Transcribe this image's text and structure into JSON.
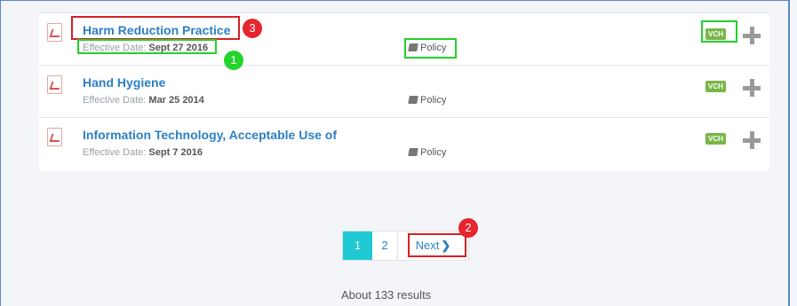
{
  "results": [
    {
      "title": "Harm Reduction Practice",
      "date_label": "Effective Date:",
      "date": "Sept 27 2016",
      "type": "Policy",
      "authority": "VCH",
      "file_icon": "pdf-icon",
      "add_icon": "plus-icon"
    },
    {
      "title": "Hand Hygiene",
      "date_label": "Effective Date:",
      "date": "Mar 25 2014",
      "type": "Policy",
      "authority": "VCH",
      "file_icon": "pdf-icon",
      "add_icon": "plus-icon"
    },
    {
      "title": "Information Technology, Acceptable Use of",
      "date_label": "Effective Date:",
      "date": "Sept 7 2016",
      "type": "Policy",
      "authority": "VCH",
      "file_icon": "pdf-icon",
      "add_icon": "plus-icon"
    }
  ],
  "pagination": {
    "page1": "1",
    "page2": "2",
    "next": "Next",
    "next_icon": "chevron-right-icon",
    "current_page": 1
  },
  "result_count": "About 133 results",
  "annotations": {
    "marker1": "1",
    "marker2": "2",
    "marker3": "3"
  },
  "colors": {
    "accent": "#2c7fc4",
    "active_page": "#1fc9d3",
    "vch_badge": "#7ab648",
    "highlight_green": "#22d22b",
    "highlight_red": "#d72027"
  }
}
